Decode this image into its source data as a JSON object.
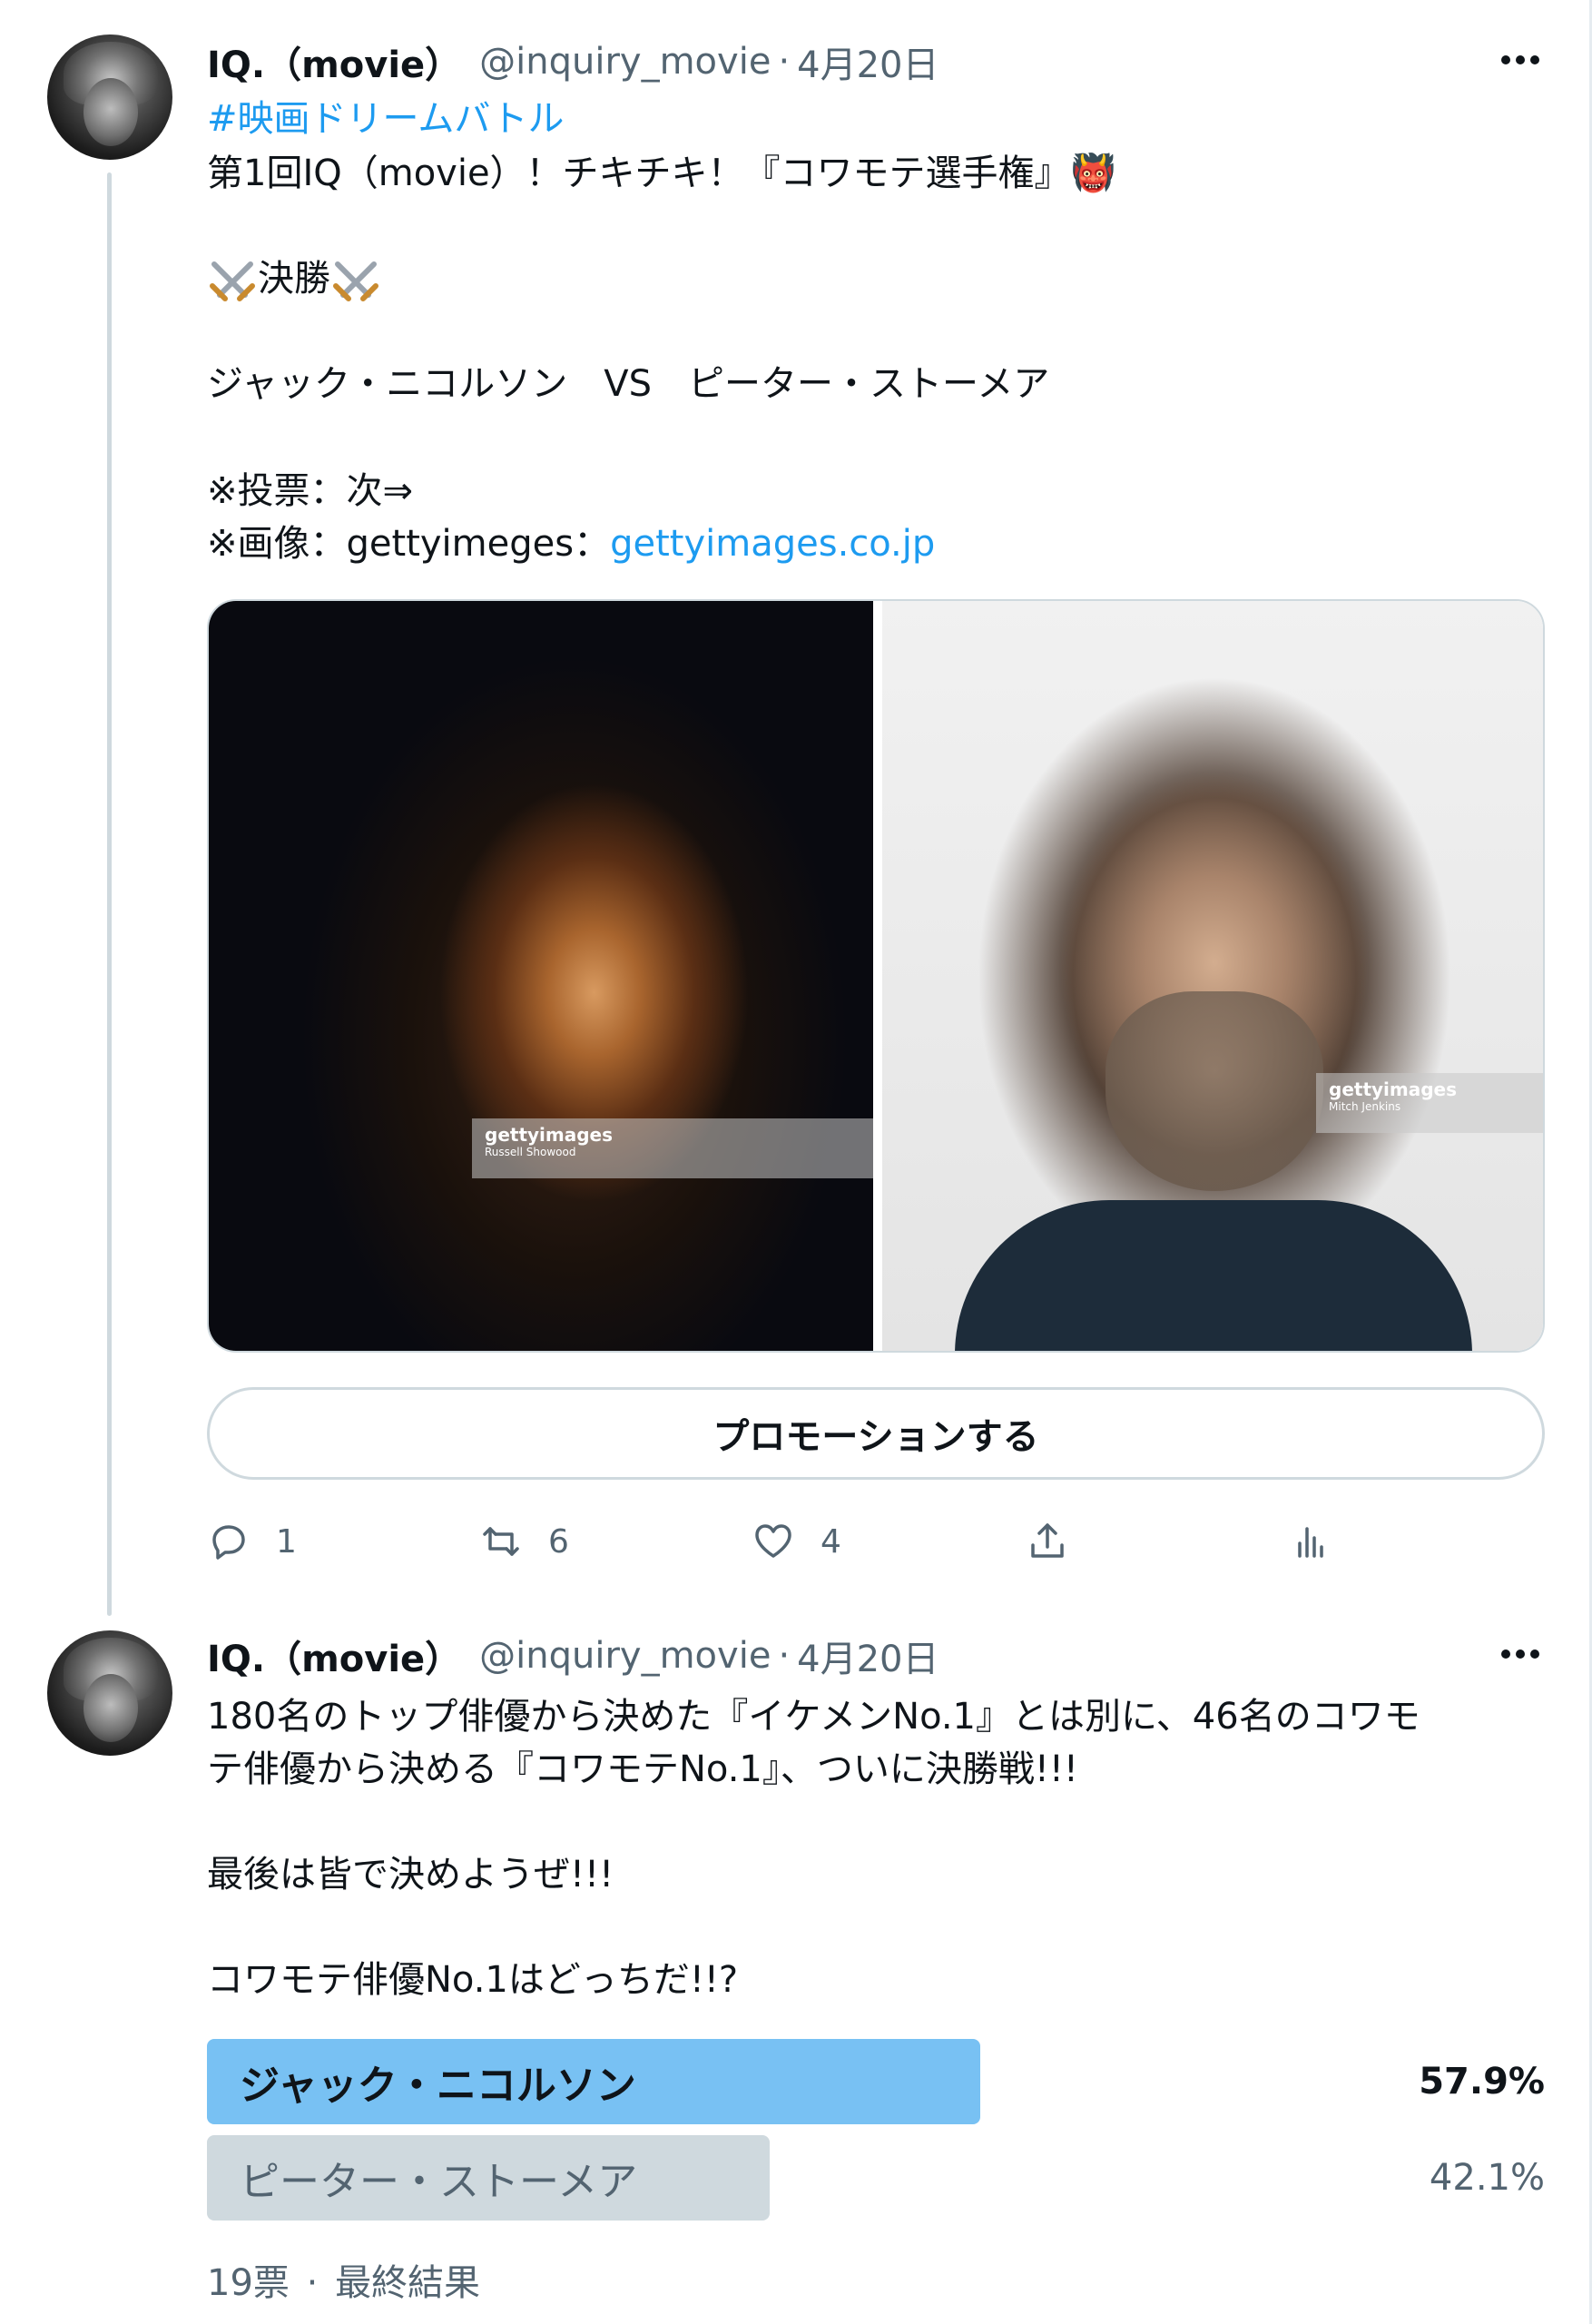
{
  "tweets": [
    {
      "author_name": "IQ.（movie）",
      "handle": "@inquiry_movie",
      "separator": "·",
      "date": "4月20日",
      "hashtag": "#映画ドリームバトル",
      "line1": "第1回IQ（movie）！チキチキ！『コワモテ選手権』",
      "emoji_oni": "👹",
      "final_label": "決勝",
      "matchup": "ジャック・ニコルソン　VS　ピーター・ストーメア",
      "vote_note": "※投票：次⇒",
      "image_note_prefix": "※画像：gettyimeges：",
      "image_link": "gettyimages.co.jp",
      "media": {
        "left_watermark": "gettyimages",
        "left_credit": "Russell Showood",
        "right_watermark": "gettyimages",
        "right_credit": "Mitch Jenkins"
      },
      "promote_label": "プロモーションする",
      "actions": {
        "reply_count": "1",
        "retweet_count": "6",
        "like_count": "4"
      }
    },
    {
      "author_name": "IQ.（movie）",
      "handle": "@inquiry_movie",
      "separator": "·",
      "date": "4月20日",
      "line1": "180名のトップ俳優から決めた『イケメンNo.1』とは別に、46名のコワモ",
      "line2": "テ俳優から決める『コワモテNo.1』、ついに決勝戦!!!",
      "line3": "最後は皆で決めようぜ!!!",
      "line4": "コワモテ俳優No.1はどっちだ!!?",
      "poll": {
        "options": [
          {
            "label": "ジャック・ニコルソン",
            "percent_text": "57.9%",
            "percent": 57.9,
            "winner": true
          },
          {
            "label": "ピーター・ストーメア",
            "percent_text": "42.1%",
            "percent": 42.1,
            "winner": false
          }
        ],
        "votes": "19票",
        "separator": "·",
        "status": "最終結果"
      }
    }
  ],
  "colors": {
    "link": "#1d9bf0",
    "poll_winner": "#78c1f3",
    "poll_other": "#cfd9de",
    "muted": "#536471"
  }
}
